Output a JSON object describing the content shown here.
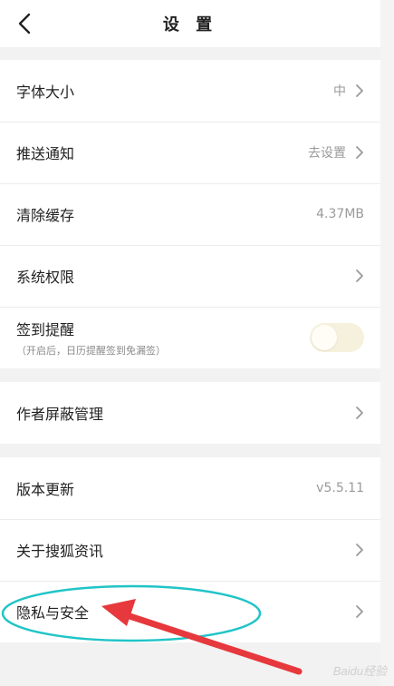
{
  "header": {
    "title": "设 置",
    "back_icon": "chevron-left-icon"
  },
  "group1": [
    {
      "label": "字体大小",
      "value": "中",
      "has_arrow": true
    },
    {
      "label": "推送通知",
      "value": "去设置",
      "has_arrow": true
    },
    {
      "label": "清除缓存",
      "value": "4.37MB",
      "has_arrow": false
    },
    {
      "label": "系统权限",
      "value": "",
      "has_arrow": true
    },
    {
      "label": "签到提醒",
      "sub": "（开启后，日历提醒签到免漏签）",
      "toggle": false
    }
  ],
  "group2": [
    {
      "label": "作者屏蔽管理",
      "has_arrow": true
    }
  ],
  "group3": [
    {
      "label": "版本更新",
      "value": "v5.5.11",
      "has_arrow": false
    },
    {
      "label": "关于搜狐资讯",
      "has_arrow": true
    },
    {
      "label": "隐私与安全",
      "has_arrow": true
    }
  ],
  "colors": {
    "annotation": "#e6383d",
    "highlight_ellipse": "#20c4c7",
    "toggle_track": "#f5f1dc"
  },
  "watermark": "Baidu经验"
}
